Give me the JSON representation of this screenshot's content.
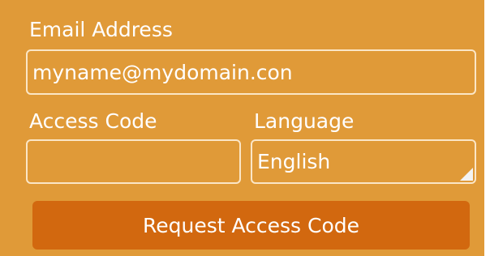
{
  "form": {
    "email": {
      "label": "Email Address",
      "value": "myname@mydomain.con"
    },
    "access_code": {
      "label": "Access Code",
      "value": ""
    },
    "language": {
      "label": "Language",
      "selected": "English"
    },
    "submit_label": "Request Access Code"
  },
  "colors": {
    "panel_background": "#e09a38",
    "field_border": "#fbe6c6",
    "button_background": "#d2680f",
    "text": "#ffffff"
  }
}
